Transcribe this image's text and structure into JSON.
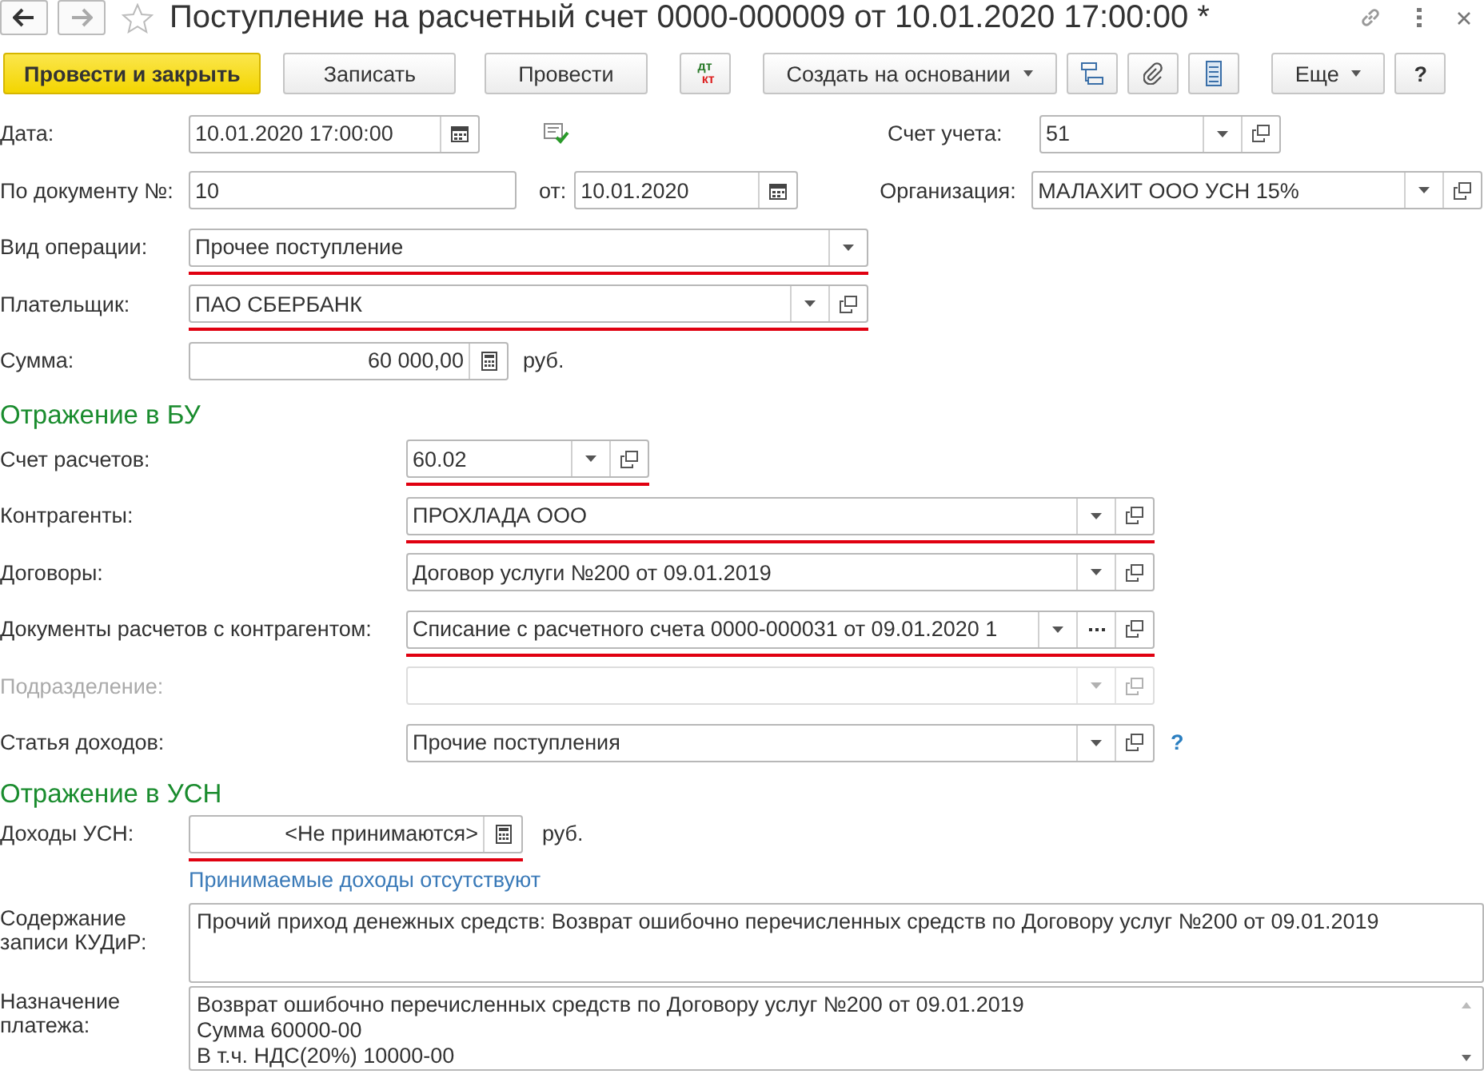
{
  "window": {
    "title": "Поступление на расчетный счет 0000-000009 от 10.01.2020 17:00:00 *"
  },
  "toolbar": {
    "post_close": "Провести и закрыть",
    "save": "Записать",
    "post": "Провести",
    "dt": "дт",
    "kt": "кт",
    "create_based": "Создать на основании",
    "more": "Еще",
    "help": "?"
  },
  "header": {
    "date": {
      "label": "Дата:",
      "value": "10.01.2020 17:00:00"
    },
    "account": {
      "label": "Счет учета:",
      "value": "51"
    },
    "doc_number": {
      "label": "По документу №:",
      "value": "10"
    },
    "doc_date": {
      "label": "от:",
      "value": "10.01.2020"
    },
    "organization": {
      "label": "Организация:",
      "value": "МАЛАХИТ ООО УСН 15%"
    },
    "operation": {
      "label": "Вид операции:",
      "value": "Прочее поступление",
      "underlined": true
    },
    "payer": {
      "label": "Плательщик:",
      "value": "ПАО СБЕРБАНК",
      "underlined": true
    },
    "amount": {
      "label": "Сумма:",
      "value": "60 000,00",
      "unit": "руб."
    }
  },
  "accounting": {
    "title": "Отражение в БУ",
    "fields": [
      {
        "label": "Счет расчетов:",
        "value": "60.02",
        "underlined": true,
        "disabled": false,
        "kind": "short"
      },
      {
        "label": "Контрагенты:",
        "value": "ПРОХЛАДА ООО",
        "underlined": true,
        "disabled": false,
        "kind": "wide"
      },
      {
        "label": "Договоры:",
        "value": "Договор услуги №200 от 09.01.2019",
        "underlined": false,
        "disabled": false,
        "kind": "wide"
      },
      {
        "label": "Документы расчетов с контрагентом:",
        "value": "Списание с расчетного счета 0000-000031 от 09.01.2020 1",
        "underlined": true,
        "disabled": false,
        "kind": "select"
      },
      {
        "label": "Подразделение:",
        "underlined": false,
        "disabled": true,
        "kind": "wide"
      },
      {
        "label": "Статья доходов:",
        "value": "Прочие поступления",
        "underlined": false,
        "disabled": false,
        "kind": "wide",
        "help": "?"
      }
    ]
  },
  "usn": {
    "title": "Отражение в УСН",
    "income": {
      "label": "Доходы УСН:",
      "value": "<Не принимаются>",
      "unit": "руб.",
      "underlined": true
    },
    "link": "Принимаемые доходы отсутствуют"
  },
  "kudir": {
    "label": "Содержание записи КУДиР:",
    "value": "Прочий приход денежных средств: Возврат ошибочно перечисленных средств по Договору услуг №200 от 09.01.2019"
  },
  "purpose": {
    "label": "Назначение платежа:",
    "lines": [
      "Возврат ошибочно перечисленных средств по Договору услуг №200 от 09.01.2019",
      "Сумма 60000-00",
      "В т.ч. НДС(20%) 10000-00"
    ]
  }
}
